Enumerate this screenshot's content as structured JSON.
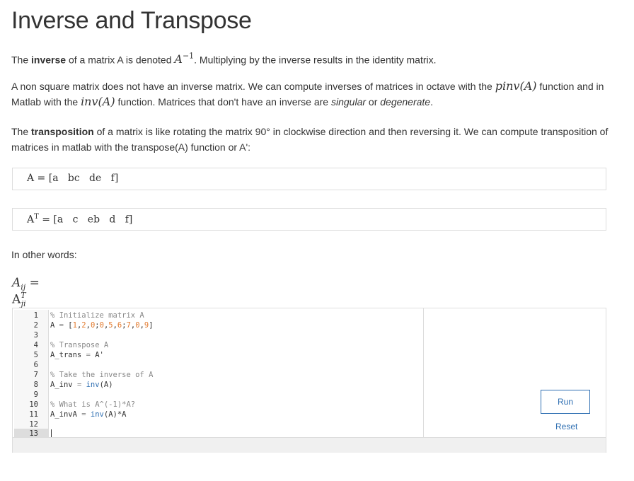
{
  "page": {
    "title": "Inverse and Transpose"
  },
  "para1": {
    "t1": "The ",
    "bold": "inverse",
    "t2": " of a matrix A is denoted ",
    "math": "A",
    "sup": "−1",
    "t3": ". Multiplying by the inverse results in the identity matrix."
  },
  "para2": {
    "t1": "A non square matrix does not have an inverse matrix. We can compute inverses of matrices in octave with the ",
    "math1": "pinv",
    "math1arg": "(A)",
    "t2": " function and in Matlab with the ",
    "math2": "inv",
    "math2arg": "(A)",
    "t3": " function. Matrices that don't have an inverse are ",
    "em1": "singular",
    "t4": " or ",
    "em2": "degenerate",
    "t5": "."
  },
  "para3": {
    "t1": "The ",
    "bold": "transposition",
    "t2": " of a matrix is like rotating the matrix 90° in clockwise direction and then reversing it. We can compute transposition of matrices in matlab with the transpose(A) function or A':"
  },
  "formula1": "A = [a   bc   de   f]",
  "formula2": {
    "lhs": "A",
    "sup": "T",
    "rhs": " = [a   c   eb   d   f]"
  },
  "other_words": "In other words:",
  "formula3": {
    "lhs": "A",
    "lsub": "ij",
    "eq": " = A",
    "rsup": "T",
    "rsub": "ji"
  },
  "editor": {
    "line_numbers": [
      "1",
      "2",
      "3",
      "4",
      "5",
      "6",
      "7",
      "8",
      "9",
      "10",
      "11",
      "12",
      "13"
    ],
    "line1": "% Initialize matrix A",
    "line2_a": "A ",
    "line2_eq": "=",
    "line2_b": " [",
    "line2_nums": [
      "1",
      "2",
      "0",
      "0",
      "5",
      "6",
      "7",
      "0",
      "9"
    ],
    "line4": "% Transpose A",
    "line5_a": "A_trans ",
    "line5_eq": "=",
    "line5_b": " A'",
    "line7": "% Take the inverse of A",
    "line8_a": "A_inv ",
    "line8_eq": "=",
    "line8_fn": " inv",
    "line8_b": "(A)",
    "line10": "% What is A^(-1)*A?",
    "line11_a": "A_invA ",
    "line11_eq": "=",
    "line11_fn": " inv",
    "line11_b": "(A)*A"
  },
  "controls": {
    "run_label": "Run",
    "reset_label": "Reset"
  },
  "colors": {
    "accent": "#2f6fb2",
    "number": "#e37b2f",
    "comment": "#888888"
  }
}
